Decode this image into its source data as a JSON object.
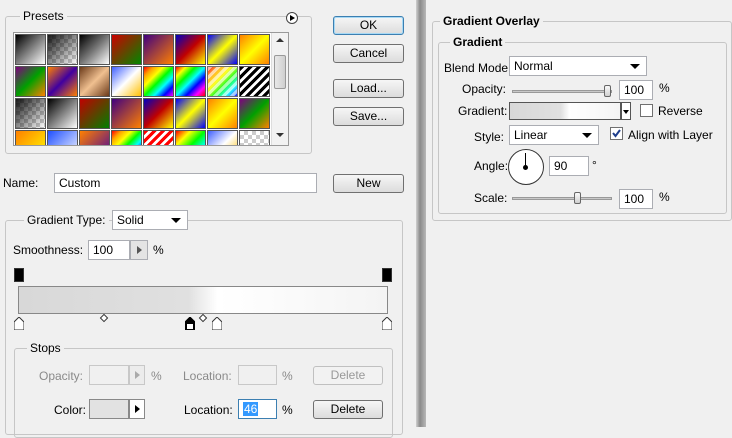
{
  "gradient_editor": {
    "presets_label": "Presets",
    "ok": "OK",
    "cancel": "Cancel",
    "load": "Load...",
    "save": "Save...",
    "name_label": "Name:",
    "name_value": "Custom",
    "new": "New",
    "gradient_type_label": "Gradient Type:",
    "gradient_type_value": "Solid",
    "smoothness_label": "Smoothness:",
    "smoothness_value": "100",
    "smoothness_unit": "%",
    "stops_label": "Stops",
    "opacity_label": "Opacity:",
    "opacity_unit": "%",
    "location_label": "Location:",
    "location_unit": "%",
    "delete": "Delete",
    "color_label": "Color:",
    "location_value": "46"
  },
  "layer_style": {
    "section_title": "Gradient Overlay",
    "group_title": "Gradient",
    "blend_mode_label": "Blend Mode:",
    "blend_mode_value": "Normal",
    "opacity_label": "Opacity:",
    "opacity_value": "100",
    "opacity_unit": "%",
    "opacity_level": 1.0,
    "gradient_label": "Gradient:",
    "reverse_label": "Reverse",
    "reverse_checked": false,
    "style_label": "Style:",
    "style_value": "Linear",
    "align_label": "Align with Layer",
    "align_checked": true,
    "angle_label": "Angle:",
    "angle_value": "90",
    "angle_unit": "°",
    "scale_label": "Scale:",
    "scale_value": "100",
    "scale_unit": "%",
    "scale_level": 0.5
  },
  "colors": {
    "selection_blue": "#3399ff",
    "focus_border": "#3c7fb1"
  }
}
